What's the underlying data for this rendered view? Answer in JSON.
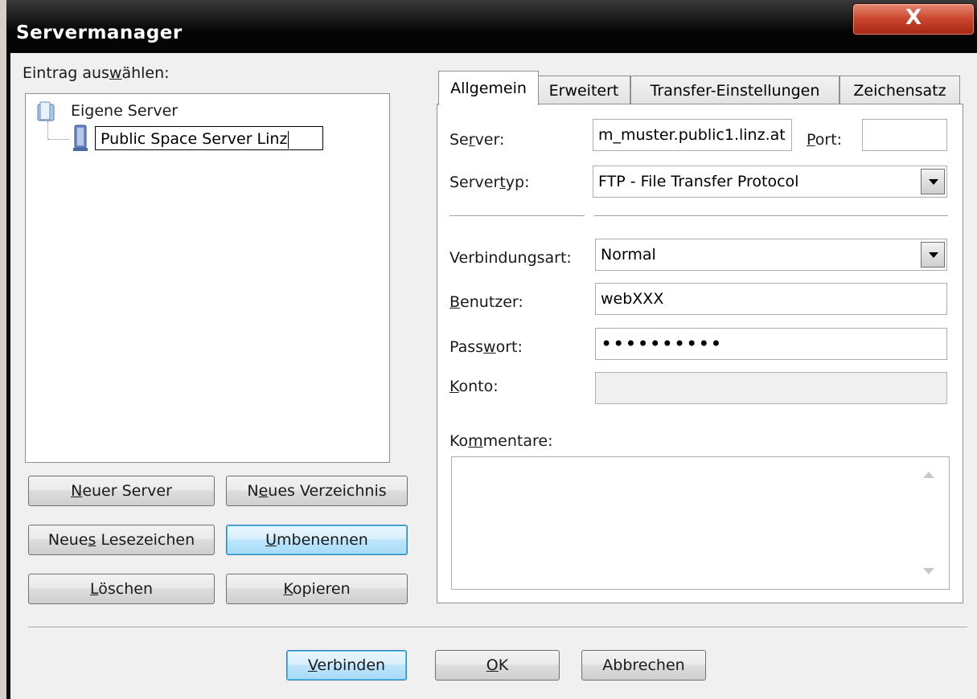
{
  "window": {
    "title": "Servermanager",
    "close_glyph": "X"
  },
  "left": {
    "select_label_pre": "Eintrag aus",
    "select_label_u": "w",
    "select_label_post": "ählen:",
    "tree": {
      "root_label": "Eigene Server",
      "root_icon": "folder-icon",
      "child_label": "Public Space Server Linz",
      "child_icon": "server-icon"
    },
    "buttons": {
      "new_server": {
        "u": "N",
        "rest": "euer Server"
      },
      "new_folder": {
        "pre": "N",
        "u": "e",
        "rest": "ues Verzeichnis"
      },
      "new_bookmark": {
        "pre": "Neue",
        "u": "s",
        "rest": " Lesezeichen"
      },
      "rename": {
        "u": "U",
        "rest": "mbenennen"
      },
      "delete": {
        "u": "L",
        "rest": "öschen"
      },
      "copy": {
        "u": "K",
        "rest": "opieren"
      }
    }
  },
  "tabs": [
    {
      "label": "Allgemein",
      "active": true
    },
    {
      "label": "Erweitert",
      "active": false
    },
    {
      "label": "Transfer-Einstellungen",
      "active": false
    },
    {
      "label": "Zeichensatz",
      "active": false
    }
  ],
  "general": {
    "server_label": {
      "pre": "Se",
      "u": "r",
      "post": "ver:"
    },
    "server_value": "m_muster.public1.linz.at",
    "port_label": {
      "u": "P",
      "post": "ort:"
    },
    "port_value": "",
    "servertype_label": {
      "pre": "Server",
      "u": "t",
      "post": "yp:"
    },
    "servertype_value": "FTP - File Transfer Protocol",
    "conntype_label": {
      "pre": "Verbindun",
      "u": "g",
      "post": "sart:"
    },
    "conntype_value": "Normal",
    "user_label": {
      "u": "B",
      "post": "enutzer:"
    },
    "user_value": "webXXX",
    "password_label": {
      "pre": "Pass",
      "u": "w",
      "post": "ort:"
    },
    "password_value": "••••••••••",
    "account_label": {
      "u": "K",
      "post": "onto:"
    },
    "account_value": "",
    "comments_label": {
      "pre": "Ko",
      "u": "m",
      "post": "mentare:"
    },
    "comments_value": ""
  },
  "footer": {
    "connect": {
      "u": "V",
      "rest": "erbinden"
    },
    "ok": {
      "u": "O",
      "rest": "K"
    },
    "cancel": "Abbrechen"
  },
  "colors": {
    "titlebar": "#050505",
    "close_button": "#c9442b",
    "focus_border": "#3c7fb1"
  }
}
